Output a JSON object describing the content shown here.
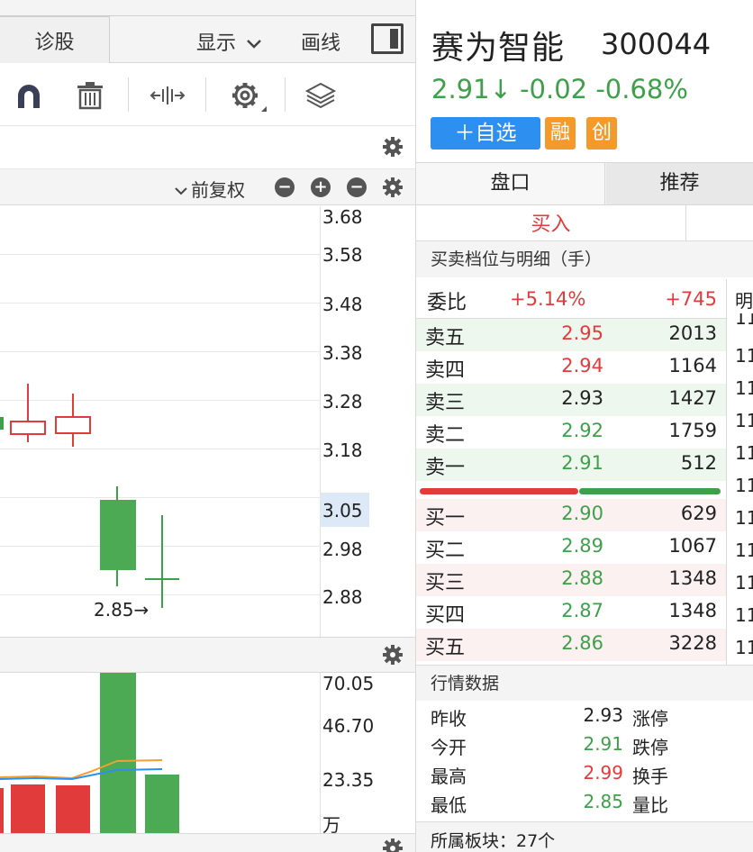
{
  "toolbar": {
    "diagnose_tab": "诊股",
    "display_menu": "显示",
    "draw_line": "画线"
  },
  "chart_settings": {
    "adjust_mode": "前复权"
  },
  "price_axis": {
    "labels": [
      "3.68",
      "3.58",
      "3.48",
      "3.38",
      "3.28",
      "3.18",
      "3.05",
      "2.98",
      "2.88"
    ],
    "highlighted": "3.05",
    "low_marker": "2.85→"
  },
  "volume_axis": {
    "labels": [
      "70.05",
      "46.70",
      "23.35"
    ],
    "unit": "万"
  },
  "stock": {
    "name": "赛为智能",
    "code": "300044",
    "quote": "2.91↓ -0.02 -0.68%",
    "add_button": "＋自选",
    "badge_margin": "融",
    "badge_chinext": "创"
  },
  "tabs": {
    "order_book": "盘口",
    "recommend": "推荐"
  },
  "trade": {
    "buy_tab": "买入"
  },
  "order_book": {
    "section_title": "买卖档位与明细（手）",
    "ratio_label": "委比",
    "ratio_pct": "+5.14%",
    "ratio_diff": "+745",
    "side_col_header": "明",
    "sell": [
      {
        "label": "卖五",
        "price": "2.95",
        "vol": "2013"
      },
      {
        "label": "卖四",
        "price": "2.94",
        "vol": "1164"
      },
      {
        "label": "卖三",
        "price": "2.93",
        "vol": "1427"
      },
      {
        "label": "卖二",
        "price": "2.92",
        "vol": "1759"
      },
      {
        "label": "卖一",
        "price": "2.91",
        "vol": "512"
      }
    ],
    "buy": [
      {
        "label": "买一",
        "price": "2.90",
        "vol": "629"
      },
      {
        "label": "买二",
        "price": "2.89",
        "vol": "1067"
      },
      {
        "label": "买三",
        "price": "2.88",
        "vol": "1348"
      },
      {
        "label": "买四",
        "price": "2.87",
        "vol": "1348"
      },
      {
        "label": "买五",
        "price": "2.86",
        "vol": "3228"
      }
    ],
    "tick_column": [
      "11",
      "11",
      "11",
      "11",
      "11",
      "11",
      "11",
      "11",
      "11",
      "11",
      "11"
    ]
  },
  "market_data": {
    "section_title": "行情数据",
    "rows": [
      {
        "label": "昨收",
        "value": "2.93",
        "label2": "涨停"
      },
      {
        "label": "今开",
        "value": "2.91",
        "label2": "跌停"
      },
      {
        "label": "最高",
        "value": "2.99",
        "label2": "换手"
      },
      {
        "label": "最低",
        "value": "2.85",
        "label2": "量比"
      }
    ]
  },
  "sector": {
    "text": "所属板块：27个"
  },
  "colors": {
    "up": "#e23b3b",
    "down": "#3f9f4a",
    "accent": "#2d8ff0",
    "badge": "#f39a2b"
  }
}
